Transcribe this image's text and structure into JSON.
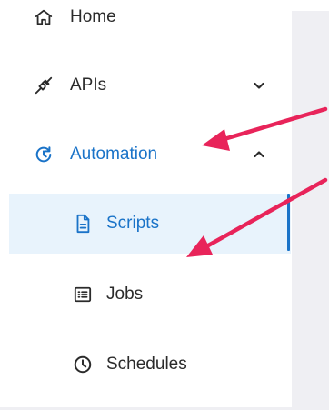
{
  "colors": {
    "accent": "#1a73c8",
    "active_bg": "#e8f3fc",
    "content_bg": "#efeff3",
    "annotation_arrow": "#e8245a"
  },
  "sidebar": {
    "items": [
      {
        "label": "Home",
        "icon": "home-icon"
      },
      {
        "label": "APIs",
        "icon": "api-plug-icon",
        "chevron": "chevron-down-icon",
        "expanded": false
      },
      {
        "label": "Automation",
        "icon": "clock-history-icon",
        "chevron": "chevron-up-icon",
        "expanded": true,
        "active": true,
        "children": [
          {
            "label": "Scripts",
            "icon": "document-icon",
            "selected": true
          },
          {
            "label": "Jobs",
            "icon": "list-box-icon"
          },
          {
            "label": "Schedules",
            "icon": "clock-icon"
          }
        ]
      }
    ]
  }
}
